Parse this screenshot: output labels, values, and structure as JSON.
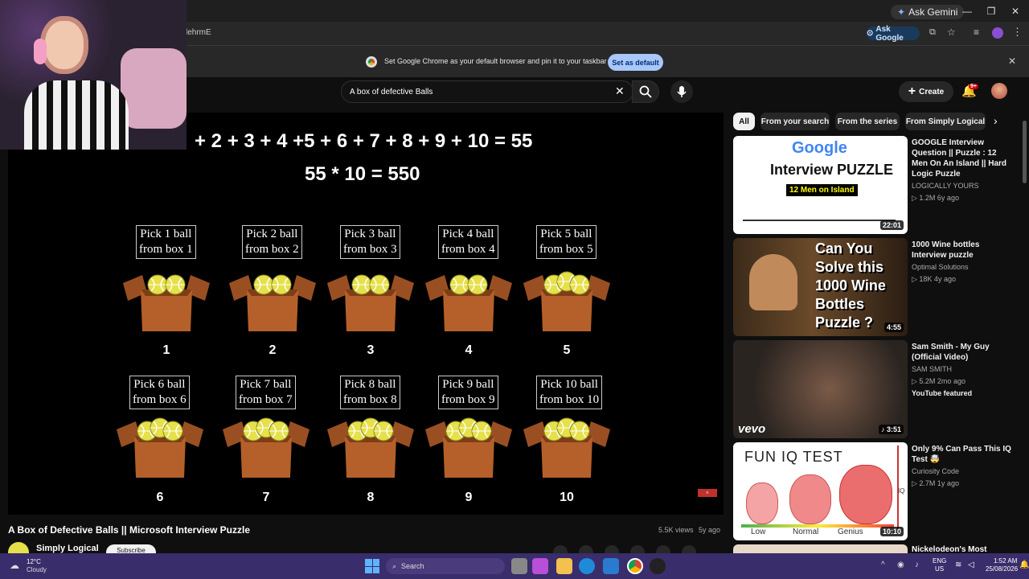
{
  "browser": {
    "ask_gemini": "Ask Gemini",
    "url_fragment": "lehrmE",
    "ask_google": "Ask Google",
    "infobar_text": "Set Google Chrome as your default browser and pin it to your taskbar",
    "set_default": "Set as default"
  },
  "yt": {
    "search_value": "A box of defective Balls",
    "create_label": "Create",
    "notif_badge": "9+"
  },
  "video": {
    "equation1": "+ 2 + 3 + 4 +5 + 6 + 7 + 8 + 9 + 10 = 55",
    "equation2": "55 * 10 = 550",
    "boxes": [
      {
        "l1": "Pick 1 ball",
        "l2": "from box 1",
        "n": "1"
      },
      {
        "l1": "Pick 2 ball",
        "l2": "from box 2",
        "n": "2"
      },
      {
        "l1": "Pick 3 ball",
        "l2": "from box 3",
        "n": "3"
      },
      {
        "l1": "Pick 4 ball",
        "l2": "from box 4",
        "n": "4"
      },
      {
        "l1": "Pick 5 ball",
        "l2": "from box 5",
        "n": "5"
      },
      {
        "l1": "Pick 6 ball",
        "l2": "from box 6",
        "n": "6"
      },
      {
        "l1": "Pick 7 ball",
        "l2": "from box 7",
        "n": "7"
      },
      {
        "l1": "Pick 8 ball",
        "l2": "from box 8",
        "n": "8"
      },
      {
        "l1": "Pick 9 ball",
        "l2": "from box 9",
        "n": "9"
      },
      {
        "l1": "Pick 10 ball",
        "l2": "from box 10",
        "n": "10"
      }
    ],
    "title": "A Box of Defective Balls || Microsoft Interview Puzzle",
    "views": "5.5K views",
    "age": "5y ago",
    "channel": "Simply Logical",
    "subscribe": "Subscribe"
  },
  "chips": [
    "All",
    "From your search",
    "From the series",
    "From Simply Logical"
  ],
  "recs": [
    {
      "title": "GOOGLE Interview Question || Puzzle : 12 Men On An Island || Hard Logic Puzzle",
      "channel": "LOGICALLY YOURS",
      "meta": "▷ 1.2M  6y ago",
      "dur": "22:01",
      "thumb_top": "Google",
      "thumb_mid": "Interview PUZZLE",
      "thumb_tag": "12 Men on Island"
    },
    {
      "title": "1000 Wine bottles Interview puzzle",
      "channel": "Optimal Solutions",
      "meta": "▷ 18K  4y ago",
      "dur": "4:55",
      "thumb_text": "Can You Solve this 1000 Wine Bottles Puzzle ?"
    },
    {
      "title": "Sam Smith - My Guy (Official Video)",
      "channel": "SAM SMITH",
      "meta": "▷ 5.2M  2mo ago",
      "extra": "YouTube featured",
      "dur": "♪ 3:51",
      "thumb_logo": "vevo"
    },
    {
      "title": "Only 9% Can Pass This IQ Test 🤯",
      "channel": "Curiosity Code",
      "meta": "▷ 2.7M  1y ago",
      "dur": "10:10",
      "thumb_title": "FUN IQ TEST",
      "iq_low": "Low",
      "iq_normal": "Normal",
      "iq_genius": "Genius",
      "iq_axis": "IQ"
    },
    {
      "title": "Nickelodeon's Most",
      "channel": "",
      "meta": "",
      "dur": ""
    }
  ],
  "taskbar": {
    "temp": "12°C",
    "weather": "Cloudy",
    "search": "Search",
    "lang1": "ENG",
    "lang2": "US",
    "time": "1:52 AM",
    "date": "25/08/2026"
  },
  "colors": {
    "accent_blue": "#8ab4f8",
    "box_brown": "#b5602a",
    "ball_yellow": "#e6e04a",
    "taskbar": "#3a2d6b"
  }
}
